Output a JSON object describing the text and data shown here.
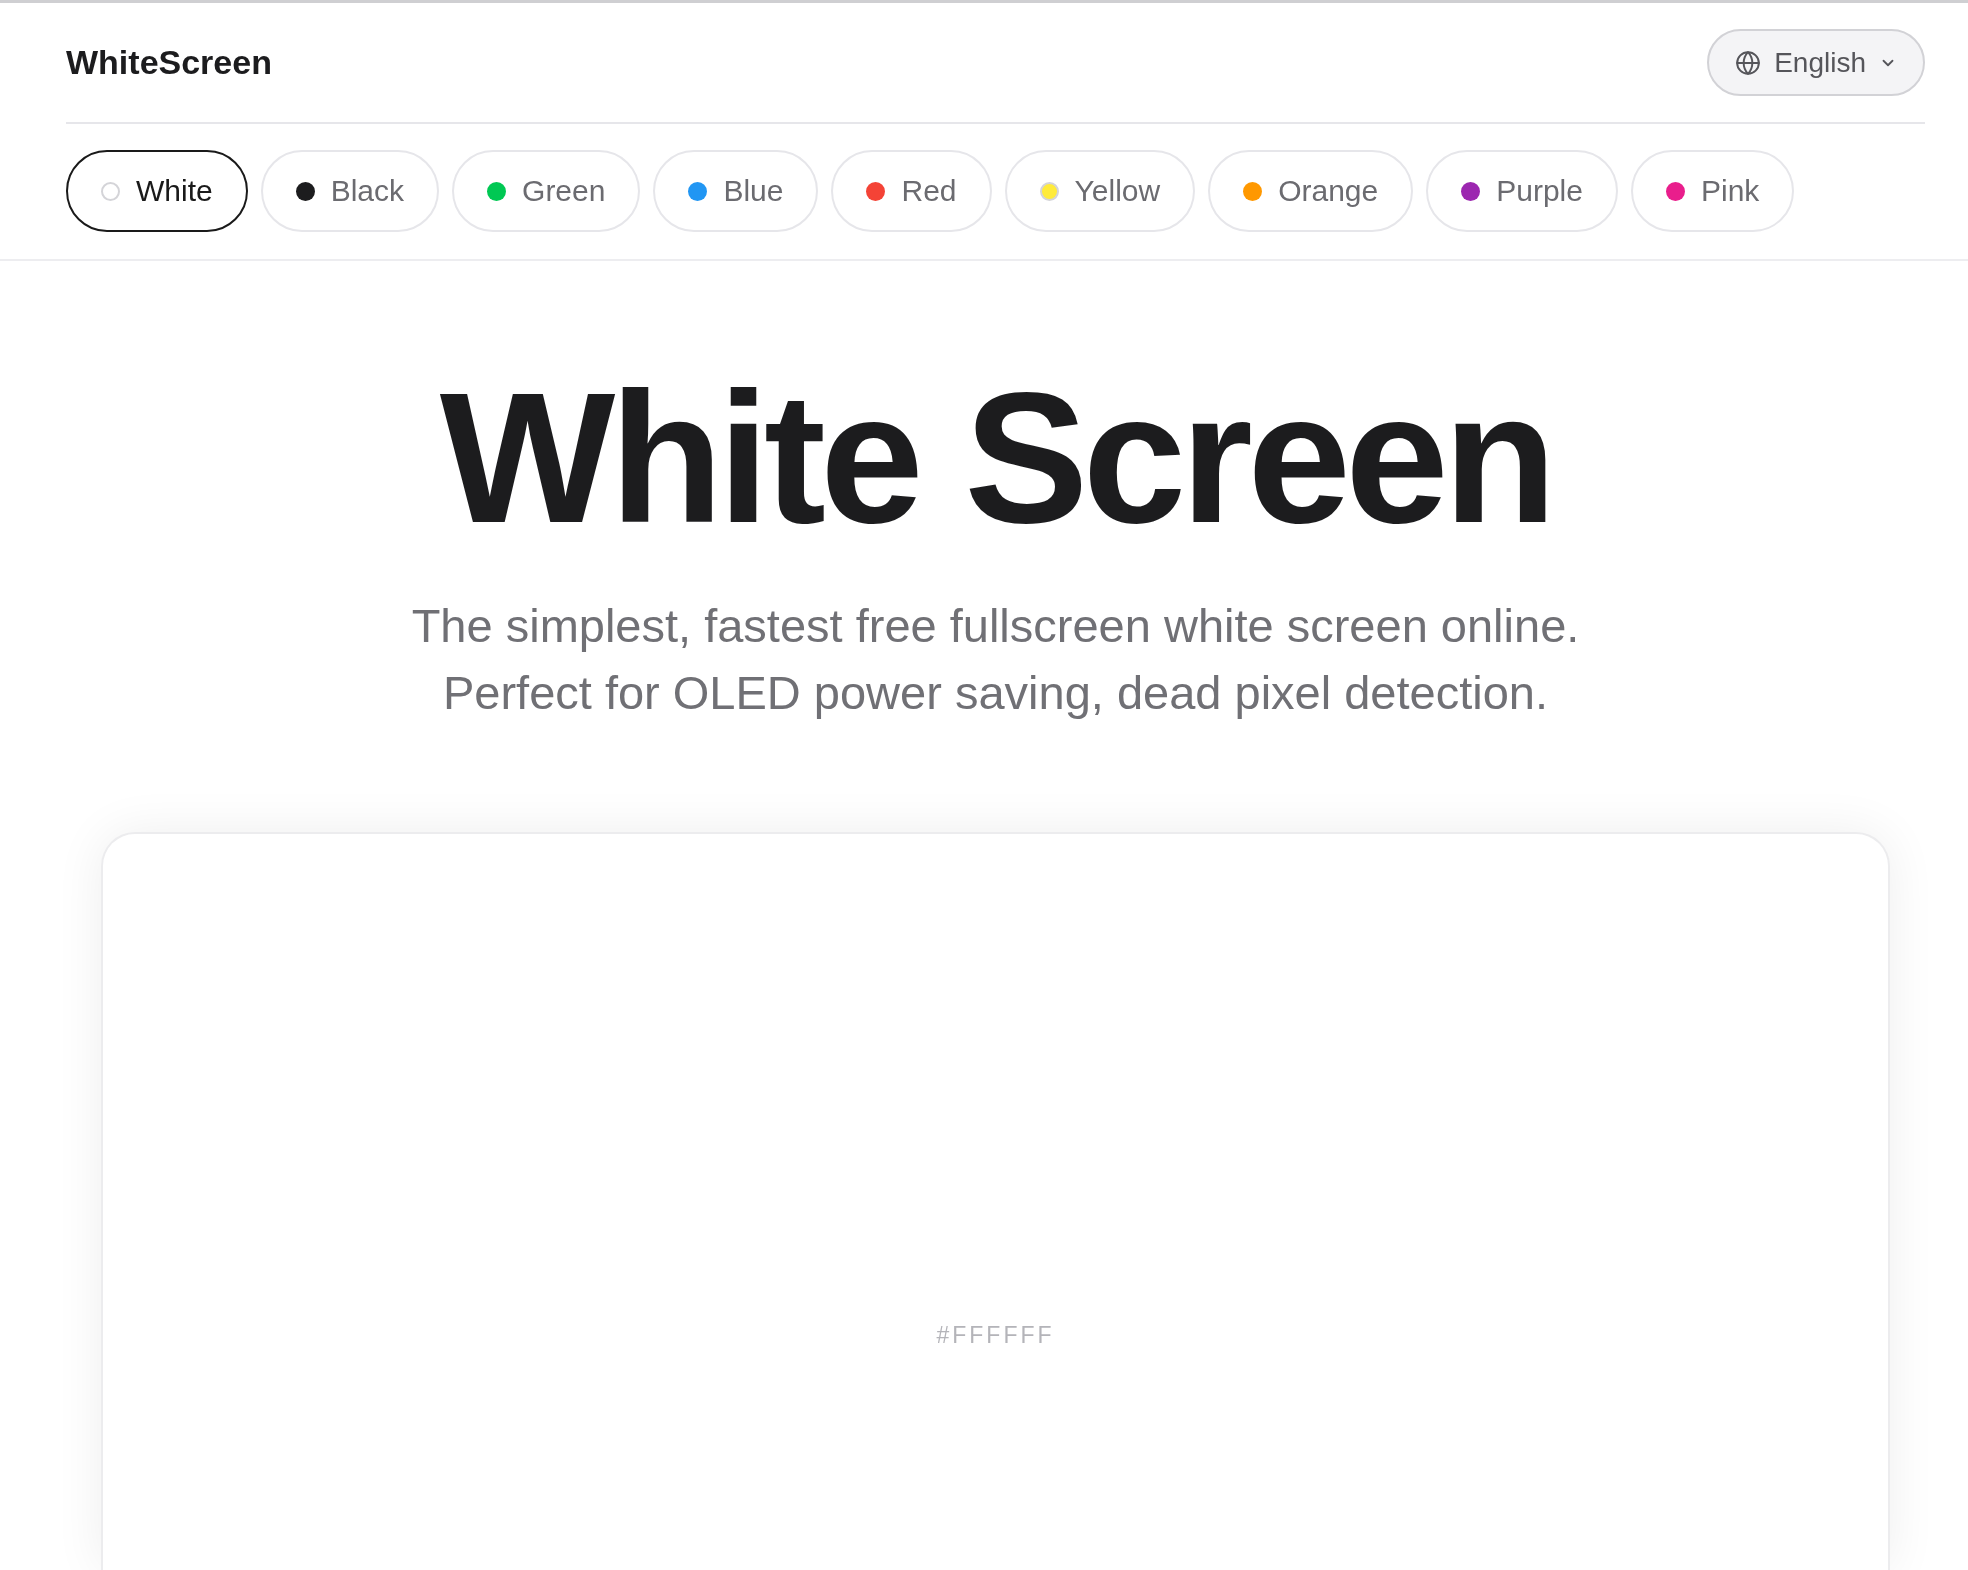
{
  "header": {
    "logo": "WhiteScreen",
    "language": {
      "label": "English"
    }
  },
  "colors": [
    {
      "label": "White",
      "color": "#ffffff",
      "selected": true
    },
    {
      "label": "Black",
      "color": "#1c1c1e",
      "selected": false
    },
    {
      "label": "Green",
      "color": "#00c853",
      "selected": false
    },
    {
      "label": "Blue",
      "color": "#2196f3",
      "selected": false
    },
    {
      "label": "Red",
      "color": "#f44336",
      "selected": false
    },
    {
      "label": "Yellow",
      "color": "#ffeb3b",
      "selected": false
    },
    {
      "label": "Orange",
      "color": "#ff9800",
      "selected": false
    },
    {
      "label": "Purple",
      "color": "#9c27b0",
      "selected": false
    },
    {
      "label": "Pink",
      "color": "#e91e8c",
      "selected": false
    }
  ],
  "hero": {
    "title": "White Screen",
    "subtitle": "The simplest, fastest free fullscreen white screen online. Perfect for OLED power saving, dead pixel detection."
  },
  "preview": {
    "label": "#FFFFFF"
  }
}
